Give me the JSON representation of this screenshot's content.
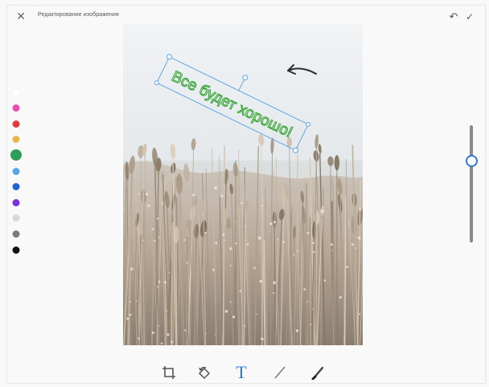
{
  "window": {
    "title": "Редактирование изображения",
    "close_icon": "close-icon",
    "undo_icon": "undo-icon",
    "done_icon": "checkmark-icon"
  },
  "palette": {
    "colors": [
      "#ffffff",
      "#e84fb0",
      "#e03a3e",
      "#e8b64a",
      "#2e9e5b",
      "#5aa7e8",
      "#1f63d6",
      "#7b2fd9",
      "#d8d8d8",
      "#7a7a7a",
      "#111111"
    ],
    "selected_index": 4
  },
  "canvas": {
    "annotation_text": "Все будет хорошо!",
    "annotation_color": "#3aa33a",
    "selection_color": "#5aa7e8"
  },
  "size_slider": {
    "value": 0.72,
    "accent": "#2f7ad6"
  },
  "toolbar": {
    "crop_icon": "crop-icon",
    "rotate_icon": "rotate-icon",
    "text_tool_label": "T",
    "line_icon": "line-icon",
    "brush_icon": "brush-icon",
    "active": "text",
    "accent": "#2f7ad6"
  }
}
